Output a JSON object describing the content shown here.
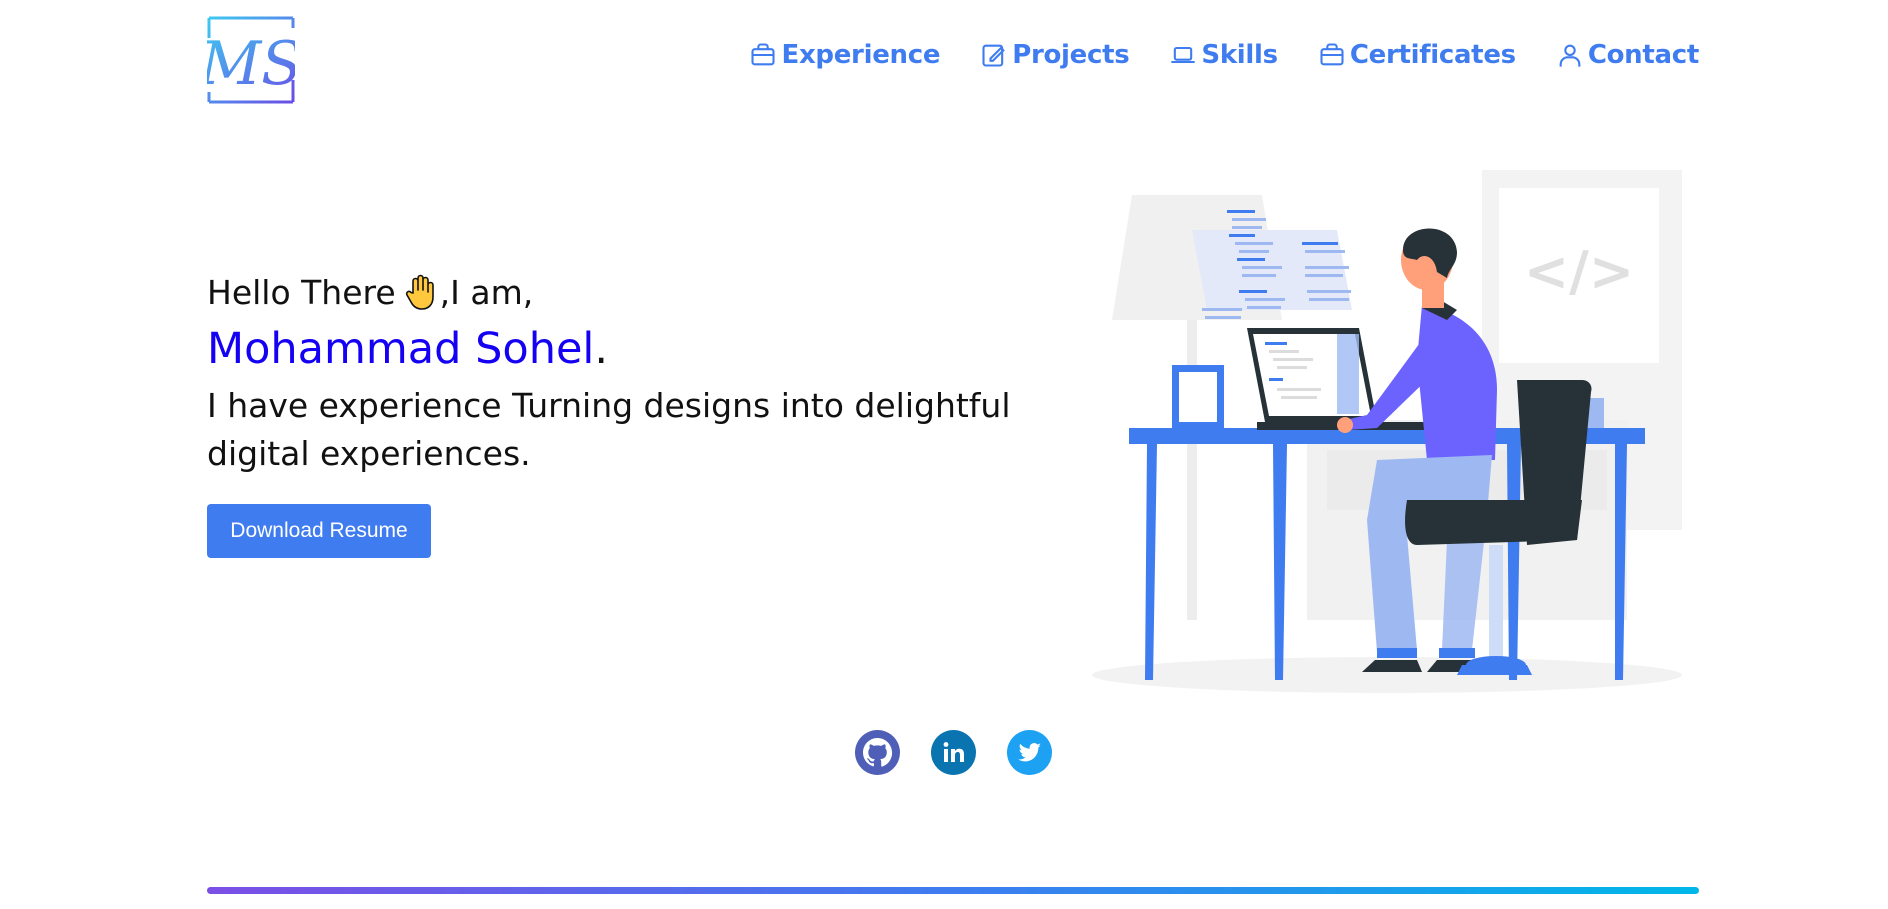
{
  "logo": {
    "text": "MS"
  },
  "nav": {
    "items": [
      {
        "label": "Experience",
        "icon": "briefcase-icon"
      },
      {
        "label": "Projects",
        "icon": "pencil-square-icon"
      },
      {
        "label": "Skills",
        "icon": "laptop-icon"
      },
      {
        "label": "Certificates",
        "icon": "briefcase-icon"
      },
      {
        "label": "Contact",
        "icon": "person-icon"
      }
    ]
  },
  "hero": {
    "greeting_prefix": "Hello There",
    "greeting_suffix": ",I am,",
    "name": "Mohammad Sohel",
    "name_dot": ".",
    "tagline": "I have experience Turning designs into delightful digital experiences.",
    "button_label": "Download Resume"
  },
  "illustration": {
    "code_symbol": "</>"
  },
  "social": [
    {
      "name": "github",
      "icon": "github-icon"
    },
    {
      "name": "linkedin",
      "icon": "linkedin-icon"
    },
    {
      "name": "twitter",
      "icon": "twitter-icon"
    }
  ],
  "colors": {
    "accent": "#3f7cf0",
    "name": "#1400f2",
    "purple": "#6c63ff",
    "dark": "#263238"
  }
}
